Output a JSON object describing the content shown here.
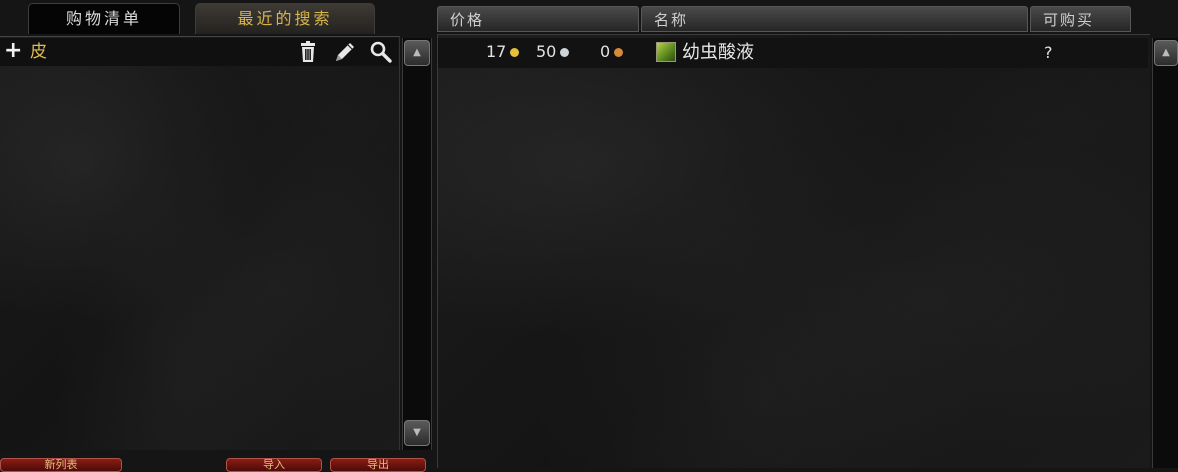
{
  "tabs": {
    "shopping_list": "购物清单",
    "recent_searches": "最近的搜索"
  },
  "list": {
    "add_glyph": "+",
    "items": [
      "皮"
    ]
  },
  "columns": {
    "price": "价格",
    "name": "名称",
    "buyable": "可购买"
  },
  "results": [
    {
      "gold": "17",
      "silver": "50",
      "copper": "0",
      "name": "幼虫酸液",
      "buyable": "?"
    }
  ],
  "bottom_buttons": [
    "新列表",
    "导入",
    "导出"
  ],
  "colors": {
    "gold_coin": "#e6c23a",
    "silver_coin": "#cfd4d8",
    "copper_coin": "#d58a3c",
    "item_name": "#e6e6e6",
    "active_tab_text": "#dcdcdc",
    "inactive_tab_text": "#d8b54a"
  },
  "icons": {
    "delete": "trash-icon",
    "edit": "pencil-icon",
    "search": "magnifier-icon",
    "item": "acid-item-icon"
  }
}
